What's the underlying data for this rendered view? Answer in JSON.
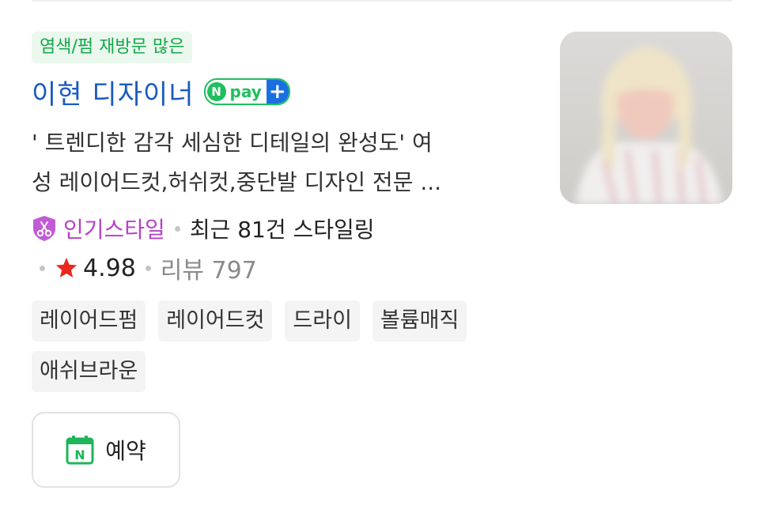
{
  "badge": "염색/펌 재방문 많은",
  "designer": {
    "name": "이현 디자이너",
    "npay_label": "pay",
    "npay_n": "N",
    "npay_plus": "+"
  },
  "description": {
    "line1": "' 트렌디한 감각 세심한 디테일의 완성도' 여",
    "line2": "성 레이어드컷,허쉬컷,중단발 디자인 전문 ..."
  },
  "meta": {
    "popular": "인기스타일",
    "recent": "최근 81건 스타일링",
    "rating": "4.98",
    "review": "리뷰 797"
  },
  "tags": [
    "레이어드펌",
    "레이어드컷",
    "드라이",
    "볼륨매직",
    "애쉬브라운"
  ],
  "reserve": {
    "label": "예약",
    "icon_letter": "N"
  },
  "colors": {
    "badge_green": "#14a84a",
    "title_blue": "#1a5bbf",
    "popular_purple": "#b640c9",
    "star_red": "#e8281e",
    "npay_green": "#1fbf5f",
    "npay_blue": "#1a6fe0"
  },
  "icons": [
    "scissors-shield-icon",
    "star-icon",
    "calendar-n-icon",
    "npay-logo-icon"
  ]
}
